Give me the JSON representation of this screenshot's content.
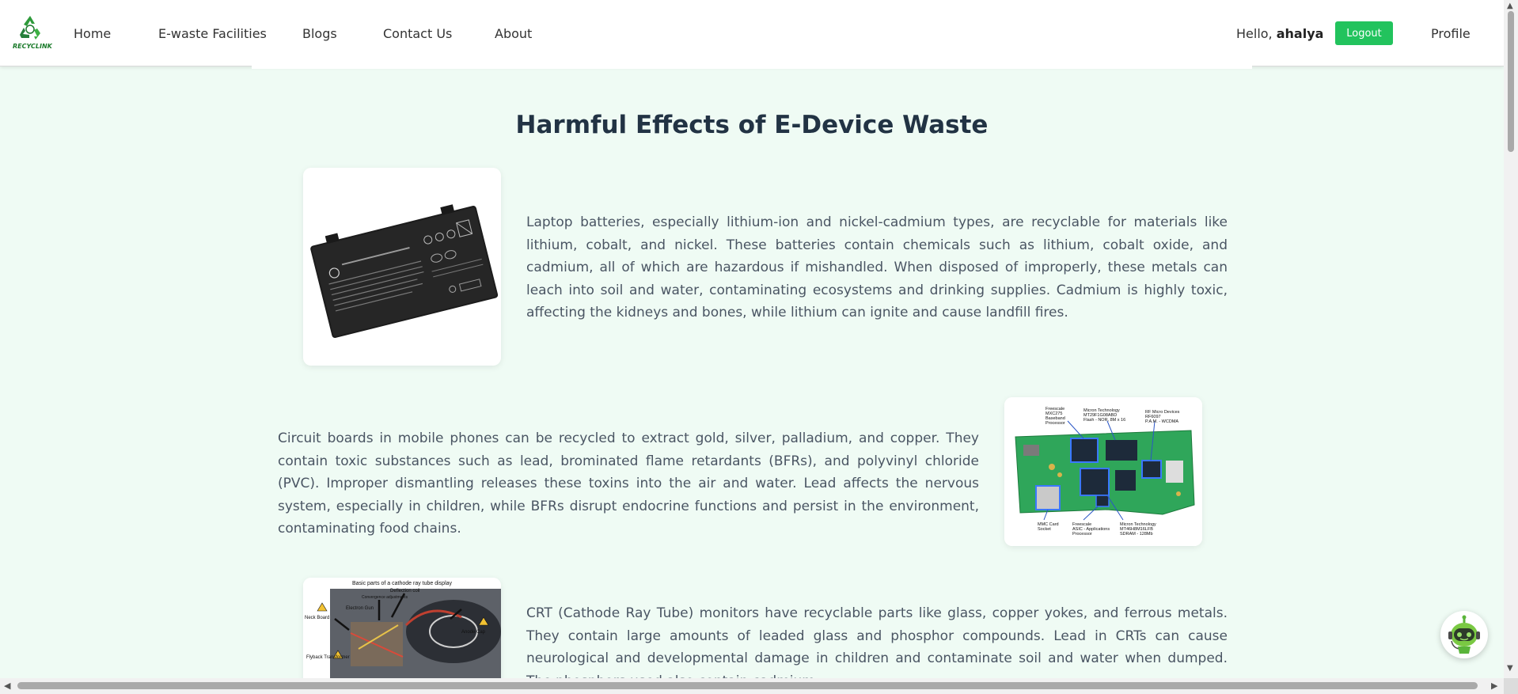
{
  "brand": {
    "logo_text": "RECYCLINK",
    "logo_icon": "recycle-icon"
  },
  "nav": {
    "home": "Home",
    "ewaste_facilities": "E-waste Facilities",
    "blogs": "Blogs",
    "contact": "Contact Us",
    "about": "About",
    "profile": "Profile"
  },
  "user": {
    "greeting": "Hello,",
    "name": "ahalya",
    "logout_label": "Logout"
  },
  "page": {
    "title": "Harmful Effects of E-Device Waste"
  },
  "sections": [
    {
      "image_name": "laptop-battery-image",
      "text": "Laptop batteries, especially lithium-ion and nickel-cadmium types, are recyclable for materials like lithium, cobalt, and nickel. These batteries contain chemicals such as lithium, cobalt oxide, and cadmium, all of which are hazardous if mishandled. When disposed of improperly, these metals can leach into soil and water, contaminating ecosystems and drinking supplies. Cadmium is highly toxic, affecting the kidneys and bones, while lithium can ignite and cause landfill fires."
    },
    {
      "image_name": "phone-circuit-board-image",
      "text": "Circuit boards in mobile phones can be recycled to extract gold, silver, palladium, and copper. They contain toxic substances such as lead, brominated flame retardants (BFRs), and polyvinyl chloride (PVC). Improper dismantling releases these toxins into the air and water. Lead affects the nervous system, especially in children, while BFRs disrupt endocrine functions and persist in the environment, contaminating food chains."
    },
    {
      "image_name": "crt-diagram-image",
      "image_caption": "Basic parts of a cathode ray tube display",
      "image_labels": [
        "Deflection coil",
        "Convergence adjustments",
        "Electron Gun",
        "Neck Board",
        "Anode Cap",
        "Flyback Transformer"
      ],
      "text": "CRT (Cathode Ray Tube) monitors have recyclable parts like glass, copper yokes, and ferrous metals. They contain large amounts of leaded glass and phosphor compounds. Lead in CRTs can cause neurological and developmental damage in children and contaminate soil and water when dumped. The phosphors used also contain cadmium"
    }
  ],
  "circuit_labels": {
    "l1": "Freescale",
    "l2": "MXC275",
    "l3": "Baseband",
    "l4": "Processor",
    "m1": "Micron Technology",
    "m2": "MT29F1G08ABD",
    "m3": "Flash - NOR, 8M x 16",
    "r1": "RF Micro Devices",
    "r2": "RF6097",
    "r3": "P.A.M. - WCDMA",
    "b1": "MMC Card",
    "b2": "Socket",
    "c1": "Freescale",
    "c2": "ASIC - Applications",
    "c3": "Processor",
    "d1": "Micron Technology",
    "d2": "MT46H8M16LFB",
    "d3": "SDRAM - 128Mb"
  },
  "colors": {
    "accent": "#22c35d",
    "background": "#effbf4",
    "title": "#223344",
    "text": "#4a5563"
  },
  "chatbot": {
    "icon": "chatbot-avatar-icon"
  }
}
